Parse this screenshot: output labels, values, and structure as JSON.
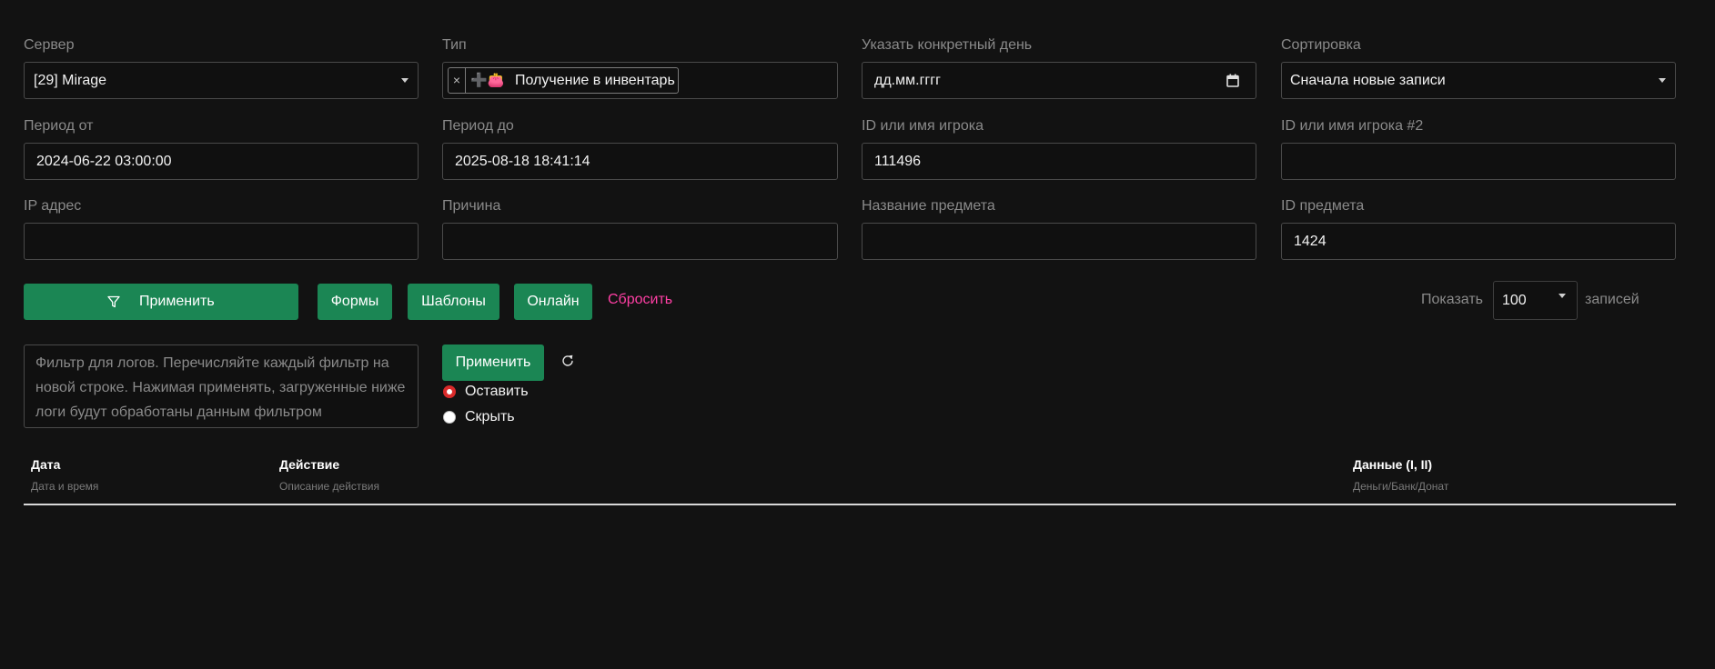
{
  "filters": {
    "server": {
      "label": "Сервер",
      "value": "[29] Mirage"
    },
    "type": {
      "label": "Тип",
      "remove": "×",
      "tag_emoji": "➕👛",
      "tag_text": "Получение в инвентарь"
    },
    "day": {
      "label": "Указать конкретный день",
      "placeholder": "дд.мм.гггг"
    },
    "sort": {
      "label": "Сортировка",
      "value": "Сначала новые записи"
    },
    "period_from": {
      "label": "Период от",
      "value": "2024-06-22 03:00:00"
    },
    "period_to": {
      "label": "Период до",
      "value": "2025-08-18 18:41:14"
    },
    "player": {
      "label": "ID или имя игрока",
      "value": "111496"
    },
    "player2": {
      "label": "ID или имя игрока #2",
      "value": ""
    },
    "ip": {
      "label": "IP адрес",
      "value": ""
    },
    "reason": {
      "label": "Причина",
      "value": ""
    },
    "item_name": {
      "label": "Название предмета",
      "value": ""
    },
    "item_id": {
      "label": "ID предмета",
      "value": "1424"
    }
  },
  "actions": {
    "apply": "Применить",
    "forms": "Формы",
    "templates": "Шаблоны",
    "online": "Онлайн",
    "reset": "Сбросить",
    "show_label": "Показать",
    "show_value": "100",
    "records_label": "записей"
  },
  "log_filter": {
    "placeholder": "Фильтр для логов. Перечисляйте каждый фильтр на новой строке. Нажимая применять, загруженные ниже логи будут обработаны данным фильтром",
    "apply": "Применить",
    "keep": "Оставить",
    "hide": "Скрыть",
    "selected": "keep"
  },
  "table": {
    "columns": [
      {
        "title": "Дата",
        "subtitle": "Дата и время"
      },
      {
        "title": "Действие",
        "subtitle": "Описание действия"
      },
      {
        "title": "Данные (I, II)",
        "subtitle": "Деньги/Банк/Донат"
      }
    ]
  },
  "colors": {
    "accent": "#1b8654",
    "link": "#ff3fa4",
    "radio": "#d92a2a"
  }
}
